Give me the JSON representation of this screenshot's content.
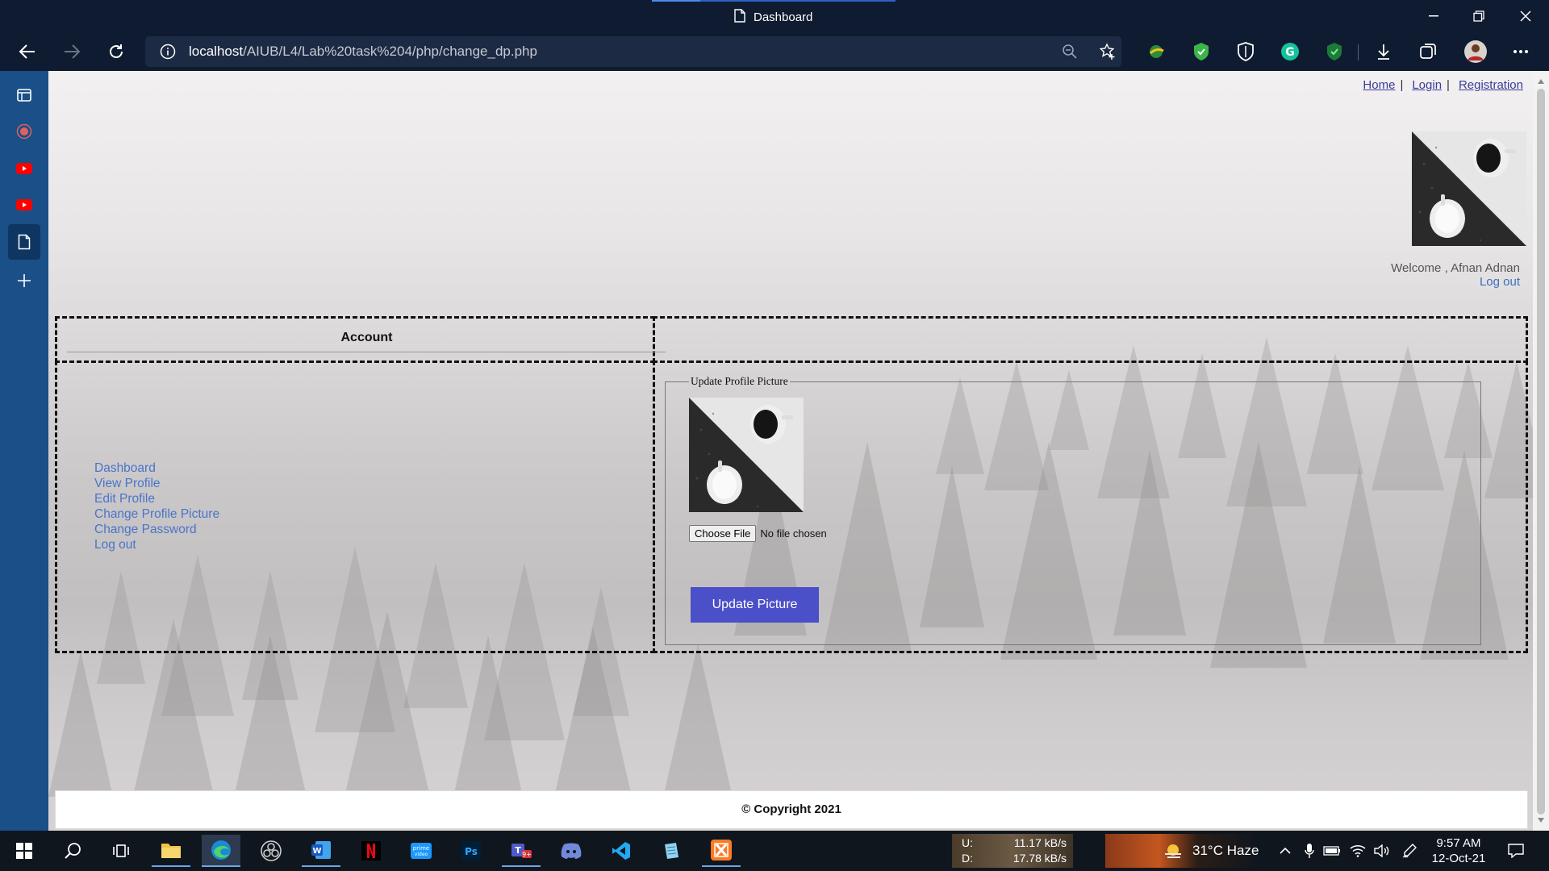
{
  "browser": {
    "window_title": "Dashboard",
    "url_host": "localhost",
    "url_path": "/AIUB/L4/Lab%20task%204/php/change_dp.php"
  },
  "page": {
    "top_links": [
      {
        "label": "Home"
      },
      {
        "label": "Login"
      },
      {
        "label": "Registration"
      }
    ],
    "top_sep": "|",
    "welcome_text": "Welcome , Afnan Adnan",
    "welcome_logout": "Log out",
    "account_title": "Account",
    "menu": [
      {
        "label": "Dashboard"
      },
      {
        "label": "View Profile"
      },
      {
        "label": "Edit Profile"
      },
      {
        "label": "Change Profile Picture"
      },
      {
        "label": "Change Password"
      },
      {
        "label": "Log out"
      }
    ],
    "fieldset_legend": "Update Profile Picture",
    "choose_file_label": "Choose File",
    "no_file_text": "No file chosen",
    "update_button": "Update Picture",
    "footer_text": "© Copyright 2021"
  },
  "taskbar": {
    "net_upload_label": "U:",
    "net_upload": "11.17 kB/s",
    "net_download_label": "D:",
    "net_download": "17.78 kB/s",
    "weather": "31°C  Haze",
    "time": "9:57 AM",
    "date": "12-Oct-21"
  },
  "colors": {
    "chrome_bg": "#0f1b30",
    "sidebar_bg": "#1a4f87",
    "link": "#3b3b9b",
    "menu_link": "#4a74c9",
    "button": "#4b4fc8"
  }
}
